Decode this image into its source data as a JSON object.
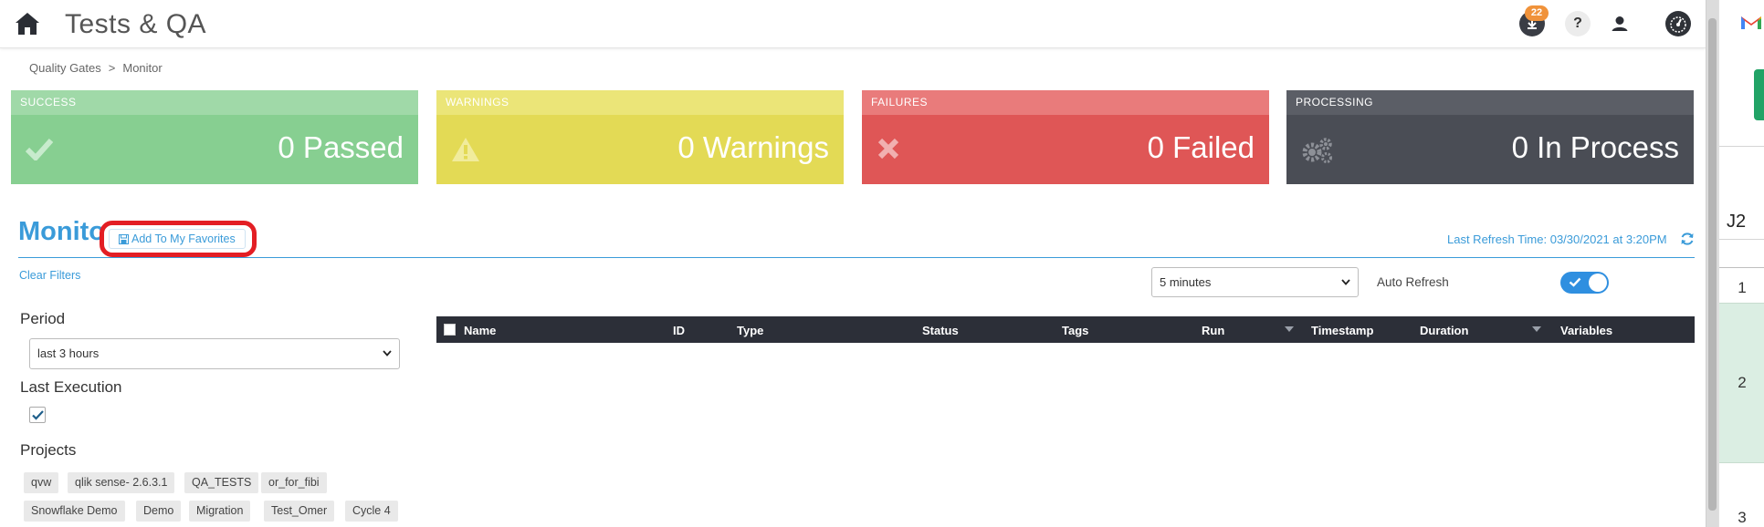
{
  "header": {
    "title": "Tests & QA",
    "notifications_count": "22",
    "help_label": "?"
  },
  "breadcrumb": {
    "items": [
      "Quality Gates",
      "Monitor"
    ],
    "separator": ">"
  },
  "cards": [
    {
      "key": "success",
      "label": "SUCCESS",
      "text": "0 Passed",
      "icon": "check-icon"
    },
    {
      "key": "warnings",
      "label": "WARNINGS",
      "text": "0 Warnings",
      "icon": "warning-icon"
    },
    {
      "key": "failures",
      "label": "FAILURES",
      "text": "0 Failed",
      "icon": "x-icon"
    },
    {
      "key": "processing",
      "label": "PROCESSING",
      "text": "0 In Process",
      "icon": "gears-icon"
    }
  ],
  "monitor": {
    "title": "Monito",
    "favorite_label": "Add To My Favorites",
    "last_refresh": "Last Refresh Time: 03/30/2021 at 3:20PM",
    "clear_filters": "Clear Filters",
    "refresh_interval": "5 minutes",
    "auto_refresh_label": "Auto Refresh",
    "auto_refresh_on": true
  },
  "filters": {
    "period_label": "Period",
    "period_value": "last 3 hours",
    "last_execution_label": "Last Execution",
    "last_execution_checked": true,
    "projects_label": "Projects",
    "projects": [
      "qvw",
      "qlik sense- 2.6.3.1",
      "QA_TESTS",
      "or_for_fibi",
      "Snowflake Demo",
      "Demo",
      "Migration",
      "Test_Omer",
      "Cycle 4"
    ]
  },
  "table": {
    "columns": [
      "Name",
      "ID",
      "Type",
      "Status",
      "Tags",
      "Run",
      "Timestamp",
      "Duration",
      "Variables"
    ],
    "rows": []
  },
  "sheet": {
    "cell_ref": "J2",
    "rows": [
      "1",
      "2",
      "3"
    ]
  },
  "colors": {
    "accent": "#3a9bd9",
    "success": "#87cf91",
    "warning": "#e3da55",
    "failure": "#df5656",
    "processing": "#4a4d55",
    "badge": "#f0923a",
    "highlight": "#e31e24"
  }
}
